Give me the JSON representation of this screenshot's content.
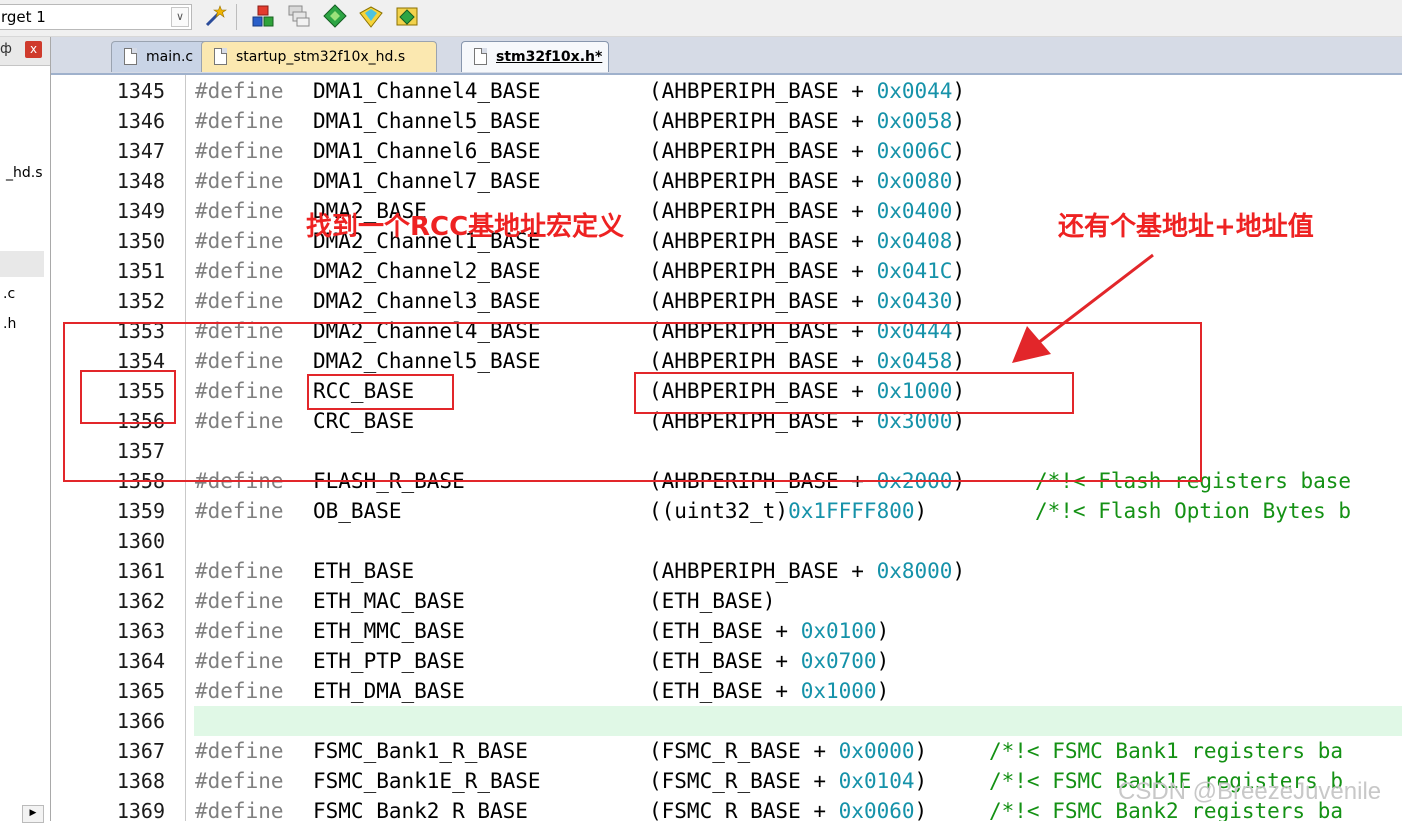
{
  "toolbar": {
    "target": "rget 1",
    "icons": [
      "magic-wand-icon",
      "manage-components-icon",
      "manage-layers-icon",
      "green-diamond-icon",
      "yellow-diamond-icon",
      "pack-installer-icon"
    ]
  },
  "project_panel": {
    "pin": "ф",
    "close": "x",
    "items": [
      "_hd.s",
      ".c",
      ".h"
    ]
  },
  "tabs": [
    {
      "label": "main.c"
    },
    {
      "label": "startup_stm32f10x_hd.s"
    },
    {
      "label": "stm32f10x.h*",
      "active": true
    }
  ],
  "code_lines": [
    {
      "n": "1345",
      "kw": "#define",
      "name": "DMA1_Channel4_BASE",
      "pre": "(AHBPERIPH_BASE + ",
      "hex": "0x0044",
      "post": ")"
    },
    {
      "n": "1346",
      "kw": "#define",
      "name": "DMA1_Channel5_BASE",
      "pre": "(AHBPERIPH_BASE + ",
      "hex": "0x0058",
      "post": ")"
    },
    {
      "n": "1347",
      "kw": "#define",
      "name": "DMA1_Channel6_BASE",
      "pre": "(AHBPERIPH_BASE + ",
      "hex": "0x006C",
      "post": ")"
    },
    {
      "n": "1348",
      "kw": "#define",
      "name": "DMA1_Channel7_BASE",
      "pre": "(AHBPERIPH_BASE + ",
      "hex": "0x0080",
      "post": ")"
    },
    {
      "n": "1349",
      "kw": "#define",
      "name": "DMA2_BASE",
      "pre": "(AHBPERIPH_BASE + ",
      "hex": "0x0400",
      "post": ")"
    },
    {
      "n": "1350",
      "kw": "#define",
      "name": "DMA2_Channel1_BASE",
      "pre": "(AHBPERIPH_BASE + ",
      "hex": "0x0408",
      "post": ")"
    },
    {
      "n": "1351",
      "kw": "#define",
      "name": "DMA2_Channel2_BASE",
      "pre": "(AHBPERIPH_BASE + ",
      "hex": "0x041C",
      "post": ")"
    },
    {
      "n": "1352",
      "kw": "#define",
      "name": "DMA2_Channel3_BASE",
      "pre": "(AHBPERIPH_BASE + ",
      "hex": "0x0430",
      "post": ")"
    },
    {
      "n": "1353",
      "kw": "#define",
      "name": "DMA2_Channel4_BASE",
      "pre": "(AHBPERIPH_BASE + ",
      "hex": "0x0444",
      "post": ")"
    },
    {
      "n": "1354",
      "kw": "#define",
      "name": "DMA2_Channel5_BASE",
      "pre": "(AHBPERIPH_BASE + ",
      "hex": "0x0458",
      "post": ")"
    },
    {
      "n": "1355",
      "kw": "#define",
      "name": "RCC_BASE",
      "pre": "(AHBPERIPH_BASE + ",
      "hex": "0x1000",
      "post": ")"
    },
    {
      "n": "1356",
      "kw": "#define",
      "name": "CRC_BASE",
      "pre": "(AHBPERIPH_BASE + ",
      "hex": "0x3000",
      "post": ")"
    },
    {
      "n": "1357",
      "kw": "",
      "name": "",
      "pre": "",
      "hex": "",
      "post": ""
    },
    {
      "n": "1358",
      "kw": "#define",
      "name": "FLASH_R_BASE",
      "pre": "(AHBPERIPH_BASE + ",
      "hex": "0x2000",
      "post": ")",
      "comment": "/*!< Flash registers base"
    },
    {
      "n": "1359",
      "kw": "#define",
      "name": "OB_BASE",
      "pre": "((uint32_t)",
      "hex": "0x1FFFF800",
      "post": ")",
      "comment": "/*!< Flash Option Bytes b"
    },
    {
      "n": "1360",
      "kw": "",
      "name": "",
      "pre": "",
      "hex": "",
      "post": ""
    },
    {
      "n": "1361",
      "kw": "#define",
      "name": "ETH_BASE",
      "pre": "(AHBPERIPH_BASE + ",
      "hex": "0x8000",
      "post": ")"
    },
    {
      "n": "1362",
      "kw": "#define",
      "name": "ETH_MAC_BASE",
      "pre": "(ETH_BASE)",
      "hex": "",
      "post": ""
    },
    {
      "n": "1363",
      "kw": "#define",
      "name": "ETH_MMC_BASE",
      "pre": "(ETH_BASE + ",
      "hex": "0x0100",
      "post": ")"
    },
    {
      "n": "1364",
      "kw": "#define",
      "name": "ETH_PTP_BASE",
      "pre": "(ETH_BASE + ",
      "hex": "0x0700",
      "post": ")"
    },
    {
      "n": "1365",
      "kw": "#define",
      "name": "ETH_DMA_BASE",
      "pre": "(ETH_BASE + ",
      "hex": "0x1000",
      "post": ")"
    },
    {
      "n": "1366",
      "kw": "",
      "name": "",
      "pre": "",
      "hex": "",
      "post": "",
      "highlight": true
    },
    {
      "n": "1367",
      "kw": "#define",
      "name": "FSMC_Bank1_R_BASE",
      "pre": "(FSMC_R_BASE + ",
      "hex": "0x0000",
      "post": ")",
      "comment2": "/*!< FSMC Bank1 registers ba"
    },
    {
      "n": "1368",
      "kw": "#define",
      "name": "FSMC_Bank1E_R_BASE",
      "pre": "(FSMC_R_BASE + ",
      "hex": "0x0104",
      "post": ")",
      "comment2": "/*!< FSMC Bank1E registers b"
    },
    {
      "n": "1369",
      "kw": "#define",
      "name": "FSMC_Bank2_R_BASE",
      "pre": "(FSMC_R_BASE + ",
      "hex": "0x0060",
      "post": ")",
      "comment2": "/*!< FSMC Bank2 registers ba"
    }
  ],
  "annotations": {
    "label1": "找到一个RCC基地址宏定义",
    "label2": "还有个基地址+地址值",
    "color": "#e2262a"
  },
  "watermark": "CSDN @BreezeJuvenile",
  "colors": {
    "keyword": "#7f7f7f",
    "hex": "#1592a9",
    "comment": "#149114",
    "current_line": "#e0f8e6"
  }
}
